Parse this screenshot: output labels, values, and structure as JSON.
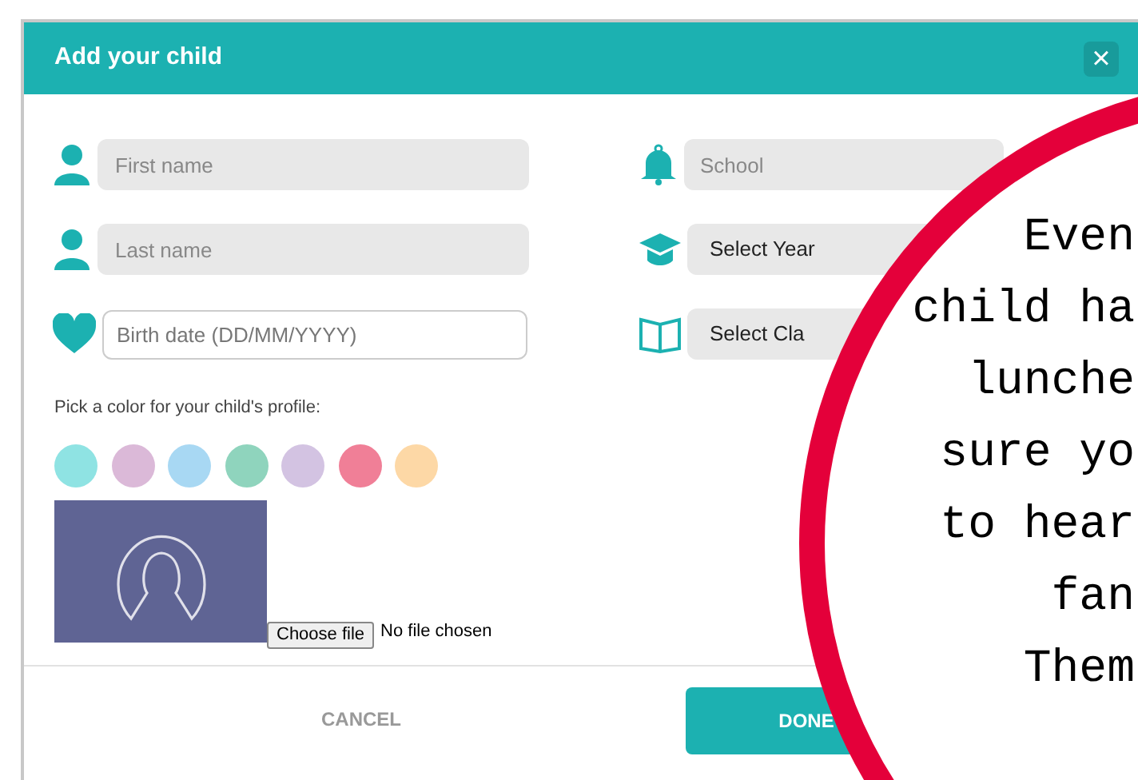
{
  "dialog": {
    "title": "Add your child",
    "close": "×"
  },
  "left_fields": [
    {
      "kind": "person",
      "placeholder": "First name"
    },
    {
      "kind": "person",
      "placeholder": "Last name"
    },
    {
      "kind": "heart",
      "placeholder": "Birth date (DD/MM/YYYY)"
    }
  ],
  "right_fields": [
    {
      "kind": "bell",
      "placeholder": "School"
    },
    {
      "kind": "cap",
      "value": "Select Year"
    },
    {
      "kind": "book",
      "value": "Select Cla"
    }
  ],
  "color_label": "Pick a color for your child's profile:",
  "colors": [
    {
      "color": "#8fe3e3"
    },
    {
      "color": "#dbb9d8"
    },
    {
      "color": "#a8d8f3"
    },
    {
      "color": "#8fd4bd"
    },
    {
      "color": "#d3c3e2"
    },
    {
      "color": "#f07f97"
    },
    {
      "color": "#fdd8a6"
    }
  ],
  "file": {
    "button": "Choose file",
    "status": "No file chosen"
  },
  "buttons": {
    "cancel": "CANCEL",
    "done": "DONE"
  },
  "overlay": {
    "lines": [
      "Even",
      "child ha",
      "lunche",
      "sure yo",
      "to hear",
      "fan",
      "Them"
    ]
  }
}
